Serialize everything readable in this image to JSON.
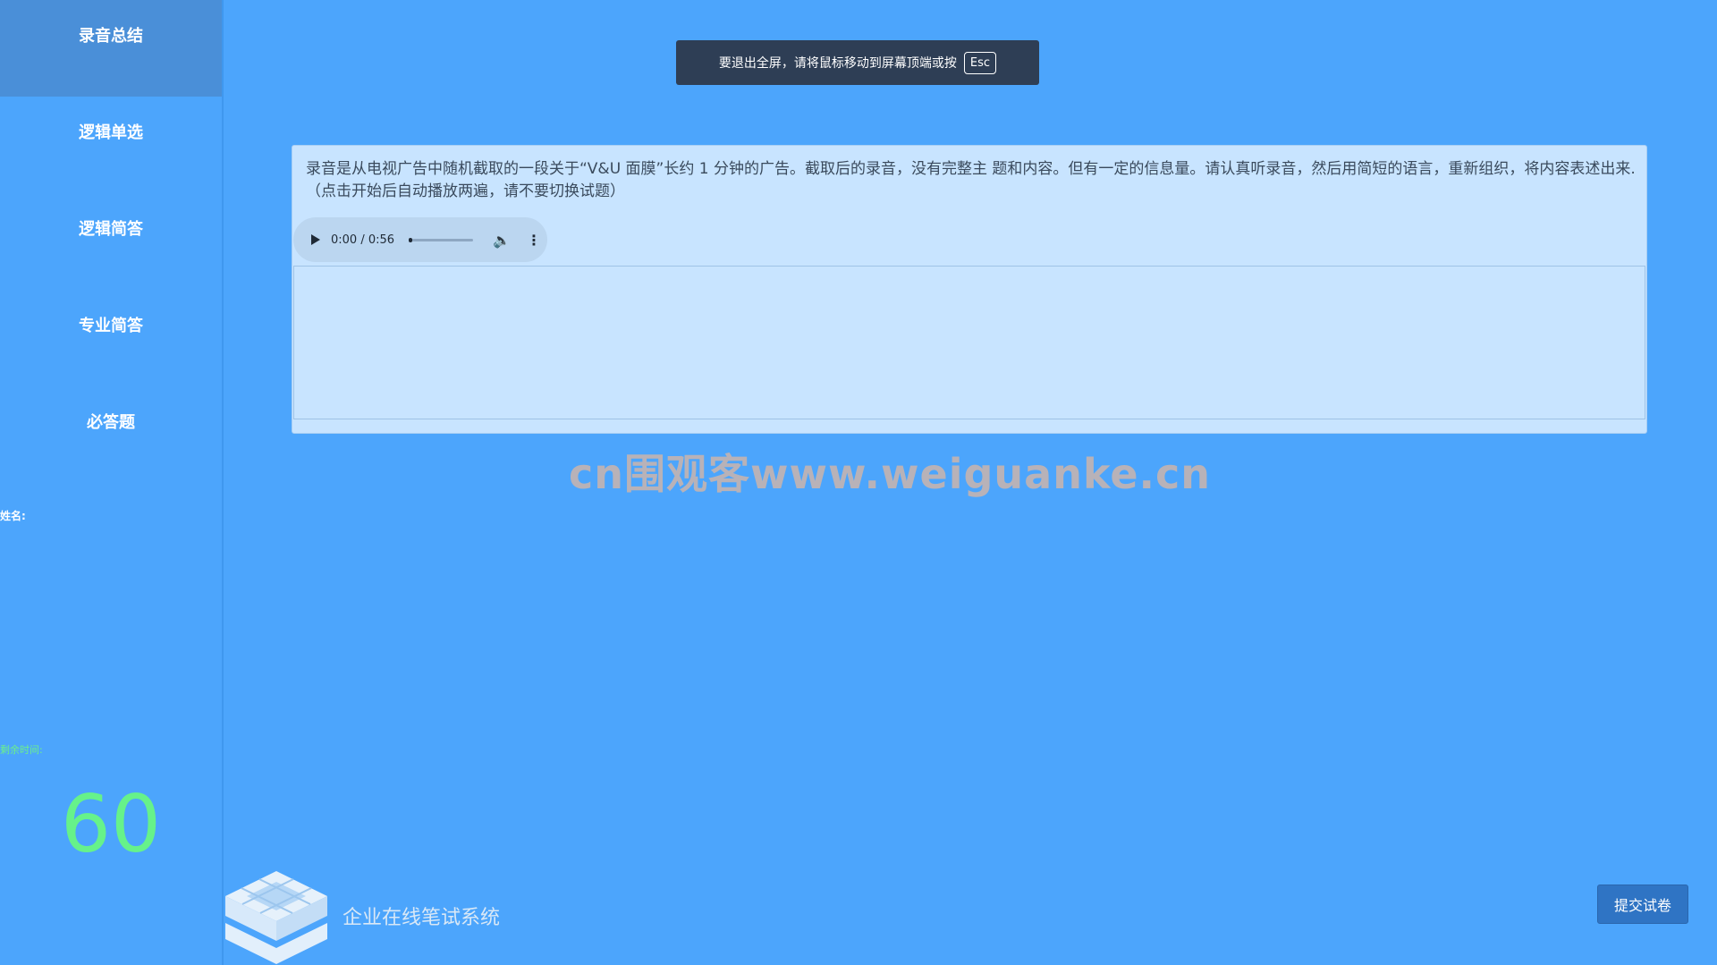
{
  "sidebar": {
    "items": [
      {
        "label": "录音总结"
      },
      {
        "label": "逻辑单选"
      },
      {
        "label": "逻辑简答"
      },
      {
        "label": "专业简答"
      },
      {
        "label": "必答题"
      }
    ],
    "name_label": "姓名:",
    "time_label": "剩余时间:",
    "time_value": "60"
  },
  "fullscreen_hint": {
    "text": "要退出全屏，请将鼠标移动到屏幕顶端或按",
    "key": "Esc"
  },
  "question": {
    "text": "录音是从电视广告中随机截取的一段关于“V&U 面膜”长约 1 分钟的广告。截取后的录音，没有完整主 题和内容。但有一定的信息量。请认真听录音，然后用简短的语言，重新组织，将内容表述出来. （点击开始后自动播放两遍，请不要切换试题）",
    "audio": {
      "time": "0:00 / 0:56",
      "progress_fraction": 0.0
    }
  },
  "watermark": "cn围观客www.weiguanke.cn",
  "footer": {
    "system_name": "企业在线笔试系统"
  },
  "submit_label": "提交试卷",
  "colors": {
    "background": "#4ca5fc",
    "active_nav": "#4a8fd8",
    "timer": "#66f28a",
    "submit": "#2f74c4"
  }
}
